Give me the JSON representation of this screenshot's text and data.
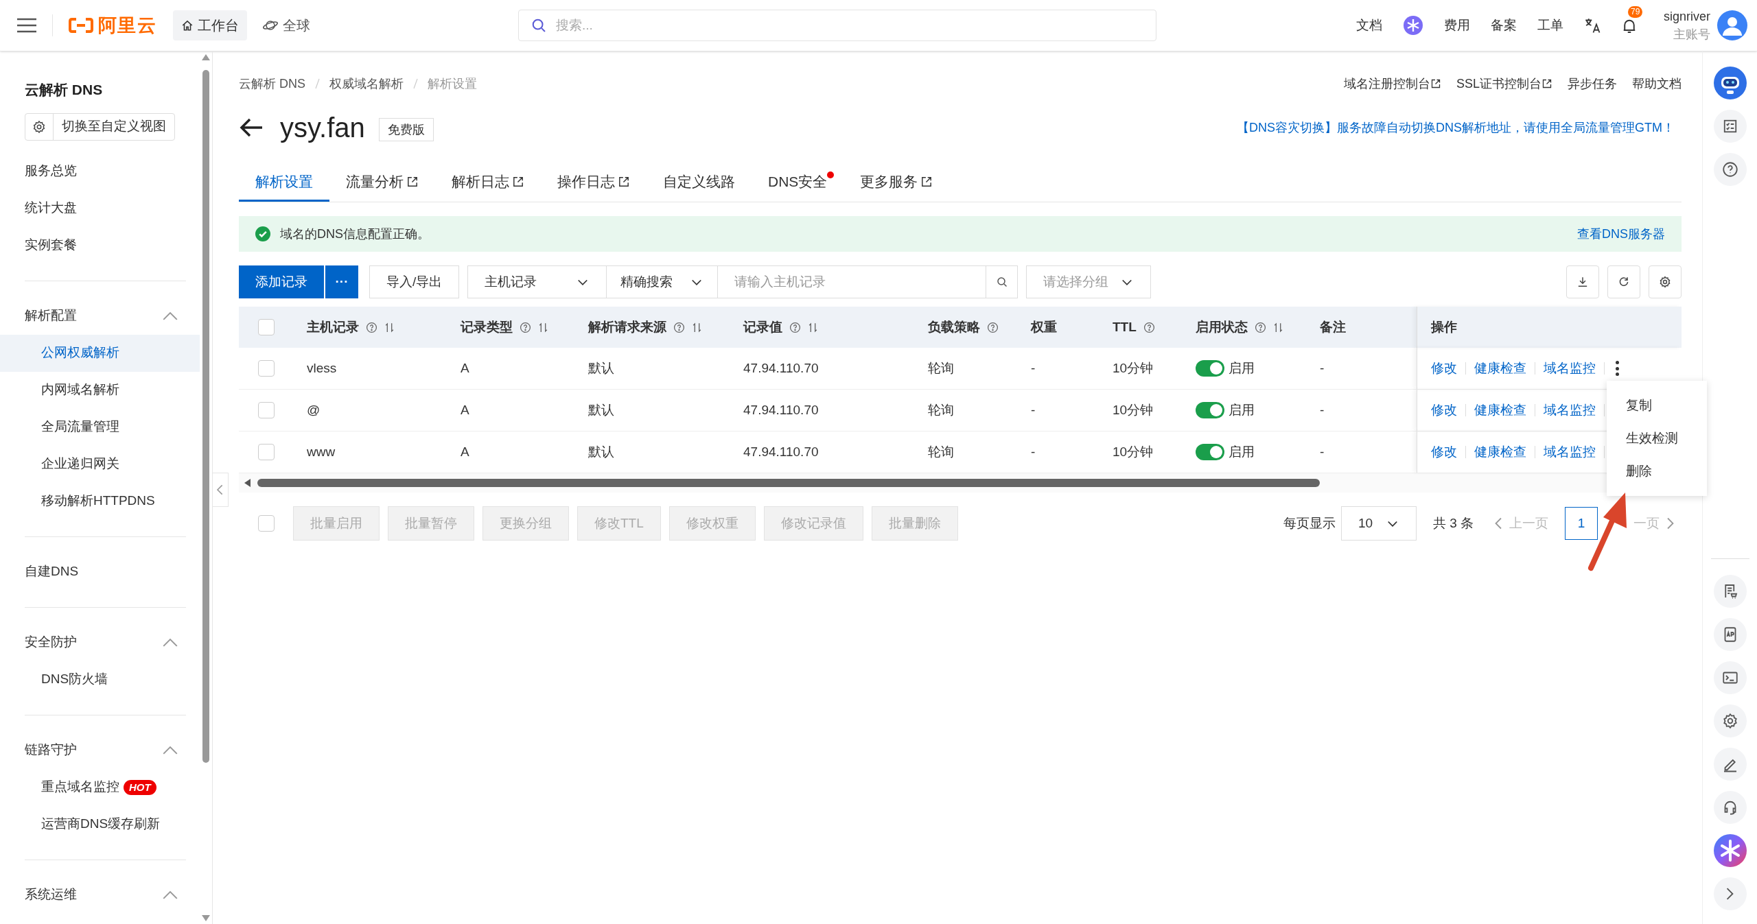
{
  "topbar": {
    "logo": "阿里云",
    "nav": [
      {
        "label": "工作台",
        "selected": true,
        "kind": "home"
      },
      {
        "label": "全球",
        "selected": false,
        "kind": "globe"
      }
    ],
    "search": {
      "placeholder": "搜索..."
    },
    "links": [
      {
        "kind": "text",
        "label": "文档"
      },
      {
        "kind": "ai"
      },
      {
        "kind": "text",
        "label": "费用"
      },
      {
        "kind": "text",
        "label": "备案"
      },
      {
        "kind": "text",
        "label": "工单"
      },
      {
        "kind": "translate"
      },
      {
        "kind": "bell",
        "badge": "79"
      }
    ],
    "user": {
      "name": "signriver",
      "role": "主账号"
    }
  },
  "sidebar": {
    "title": "云解析 DNS",
    "view_button": "切换至自定义视图",
    "sections": [
      {
        "items": [
          {
            "label": "服务总览",
            "selected": false
          },
          {
            "label": "统计大盘",
            "selected": false
          },
          {
            "label": "实例套餐",
            "selected": false
          }
        ]
      },
      {
        "heading": "解析配置",
        "expanded": true,
        "items": [
          {
            "label": "公网权威解析",
            "selected": true
          },
          {
            "label": "内网域名解析",
            "selected": false
          },
          {
            "label": "全局流量管理",
            "selected": false
          },
          {
            "label": "企业递归网关",
            "selected": false
          },
          {
            "label": "移动解析HTTPDNS",
            "selected": false
          }
        ]
      },
      {
        "items": [
          {
            "label": "自建DNS",
            "selected": false
          }
        ]
      },
      {
        "heading": "安全防护",
        "expanded": true,
        "items": [
          {
            "label": "DNS防火墙",
            "selected": false
          }
        ]
      },
      {
        "heading": "链路守护",
        "expanded": true,
        "items": [
          {
            "label": "重点域名监控",
            "selected": false,
            "badge": "HOT"
          },
          {
            "label": "运营商DNS缓存刷新",
            "selected": false
          }
        ]
      },
      {
        "heading": "系统运维",
        "expanded": true
      }
    ]
  },
  "breadcrumb": [
    "云解析 DNS",
    "权威域名解析",
    "解析设置"
  ],
  "header_links": [
    {
      "label": "域名注册控制台",
      "external": true
    },
    {
      "label": "SSL证书控制台",
      "external": true
    },
    {
      "label": "异步任务",
      "external": false
    },
    {
      "label": "帮助文档",
      "external": false
    }
  ],
  "title": "ysy.fan",
  "edition": "免费版",
  "notice": "【DNS容灾切换】服务故障自动切换DNS解析地址，请使用全局流量管理GTM！",
  "tabs": [
    {
      "label": "解析设置",
      "selected": true,
      "external": false,
      "dot": false
    },
    {
      "label": "流量分析",
      "selected": false,
      "external": true,
      "dot": false
    },
    {
      "label": "解析日志",
      "selected": false,
      "external": true,
      "dot": false
    },
    {
      "label": "操作日志",
      "selected": false,
      "external": true,
      "dot": false
    },
    {
      "label": "自定义线路",
      "selected": false,
      "external": false,
      "dot": false
    },
    {
      "label": "DNS安全",
      "selected": false,
      "external": false,
      "dot": true
    },
    {
      "label": "更多服务",
      "selected": false,
      "external": true,
      "dot": false
    }
  ],
  "alert": {
    "message": "域名的DNS信息配置正确。",
    "link": "查看DNS服务器"
  },
  "toolbar": {
    "add_button": "添加记录",
    "more_button": "···",
    "import_button": "导入/导出",
    "field_select": "主机记录",
    "match_select": "精确搜索",
    "search_placeholder": "请输入主机记录",
    "group_placeholder": "请选择分组"
  },
  "table": {
    "header_checked": false,
    "columns": [
      {
        "label": "主机记录",
        "help": true,
        "sortable": true
      },
      {
        "label": "记录类型",
        "help": true,
        "sortable": true
      },
      {
        "label": "解析请求来源",
        "help": true,
        "sortable": true
      },
      {
        "label": "记录值",
        "help": true,
        "sortable": true
      },
      {
        "label": "负载策略",
        "help": true,
        "sortable": false
      },
      {
        "label": "权重",
        "help": false,
        "sortable": false
      },
      {
        "label": "TTL",
        "help": true,
        "sortable": false
      },
      {
        "label": "启用状态",
        "help": true,
        "sortable": true
      },
      {
        "label": "备注",
        "help": false,
        "sortable": false
      },
      {
        "label": "操作",
        "help": false,
        "sortable": false
      }
    ],
    "rows": [
      {
        "checked": false,
        "host": "vless",
        "type": "A",
        "source": "默认",
        "value": "47.94.110.70",
        "policy": "轮询",
        "weight": "-",
        "ttl": "10分钟",
        "enabled": true,
        "status": "启用",
        "remark": "-",
        "actions": [
          "修改",
          "健康检查",
          "域名监控"
        ],
        "menu_open": true
      },
      {
        "checked": false,
        "host": "@",
        "type": "A",
        "source": "默认",
        "value": "47.94.110.70",
        "policy": "轮询",
        "weight": "-",
        "ttl": "10分钟",
        "enabled": true,
        "status": "启用",
        "remark": "-",
        "actions": [
          "修改",
          "健康检查",
          "域名监控"
        ],
        "menu_open": false
      },
      {
        "checked": false,
        "host": "www",
        "type": "A",
        "source": "默认",
        "value": "47.94.110.70",
        "policy": "轮询",
        "weight": "-",
        "ttl": "10分钟",
        "enabled": true,
        "status": "启用",
        "remark": "-",
        "actions": [
          "修改",
          "健康检查",
          "域名监控"
        ],
        "menu_open": false
      }
    ]
  },
  "row_menu": [
    "复制",
    "生效检测",
    "删除"
  ],
  "batch": {
    "checked": false,
    "buttons": [
      "批量启用",
      "批量暂停",
      "更换分组",
      "修改TTL",
      "修改权重",
      "修改记录值",
      "批量删除"
    ]
  },
  "pagination": {
    "per_page_label": "每页显示",
    "per_page": "10",
    "total": "共 3 条",
    "prev": "上一页",
    "next": "一页",
    "pages": [
      {
        "label": "1",
        "selected": true
      }
    ]
  }
}
